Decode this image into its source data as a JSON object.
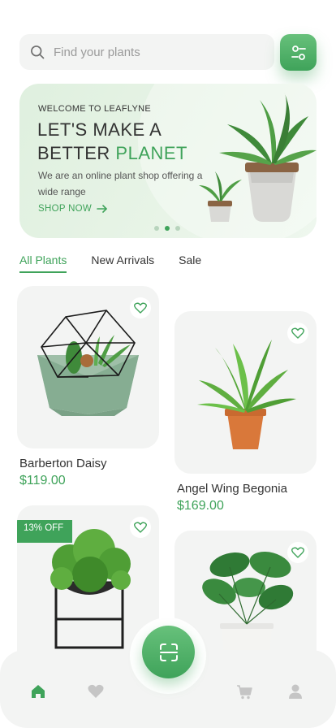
{
  "search": {
    "placeholder": "Find your plants"
  },
  "banner": {
    "eyebrow": "WELCOME TO LEAFLYNE",
    "title_line1": "LET'S MAKE A",
    "title_line2_part1": "BETTER ",
    "title_line2_accent": "PLANET",
    "description": "We are an online plant shop offering a wide range",
    "cta_label": "SHOP NOW",
    "carousel_dots": 3,
    "carousel_active_index": 1
  },
  "tabs": [
    {
      "label": "All Plants",
      "active": true
    },
    {
      "label": "New Arrivals",
      "active": false
    },
    {
      "label": "Sale",
      "active": false
    }
  ],
  "products": [
    {
      "name": "Barberton Daisy",
      "price": "$119.00",
      "badge": ""
    },
    {
      "name": "Angel Wing Begonia",
      "price": "$169.00",
      "badge": ""
    },
    {
      "name": "",
      "price": "",
      "badge": "13% OFF"
    },
    {
      "name": "",
      "price": "",
      "badge": ""
    }
  ],
  "bottom_nav": {
    "items": [
      "home-icon",
      "heart-icon",
      "scan-icon",
      "cart-icon",
      "profile-icon"
    ],
    "active": "home-icon"
  },
  "colors": {
    "accent": "#3fa35a",
    "surface": "#f3f4f3",
    "banner_bg": "#e2f1e2"
  }
}
